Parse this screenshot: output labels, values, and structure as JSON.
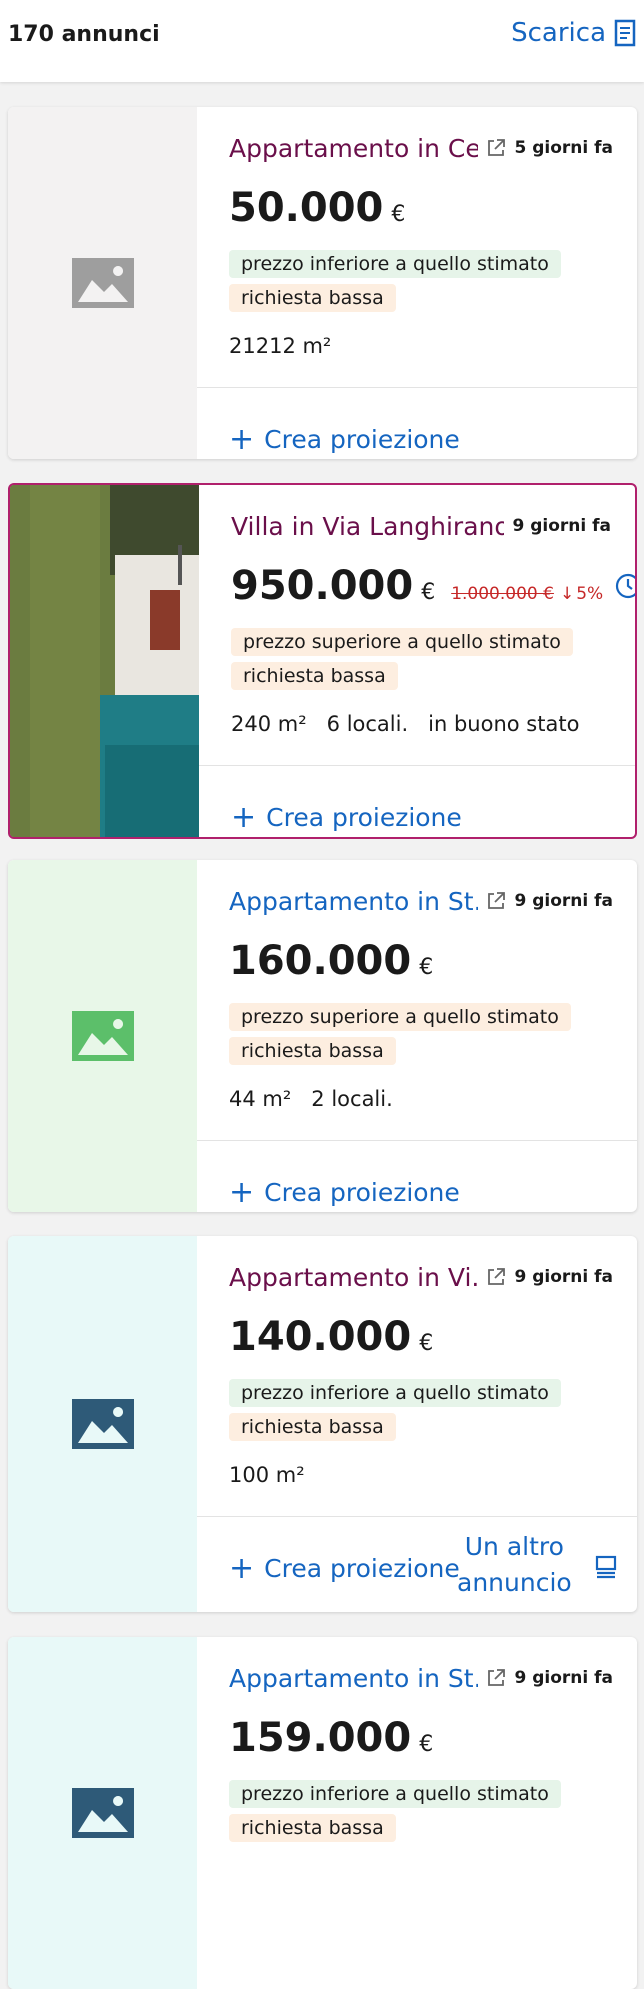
{
  "header": {
    "count": "170 annunci",
    "download_label": "Scarica"
  },
  "listings": [
    {
      "title": "Appartamento in Ce...",
      "age": "5 giorni fa",
      "price": "50.000",
      "currency": "€",
      "badges": [
        {
          "text": "prezzo inferiore a quello stimato",
          "kind": "green"
        },
        {
          "text": "richiesta bassa",
          "kind": "orange"
        }
      ],
      "features": "21212 m²",
      "action": "Crea proiezione",
      "thumb_bg": "#f3f2f2",
      "icon_color": "#9e9e9e"
    },
    {
      "title": "Villa in Via Langhirano",
      "age": "9 giorni fa",
      "price": "950.000",
      "currency": "€",
      "old_price": "1.000.000 €",
      "drop": "5%",
      "badges": [
        {
          "text": "prezzo superiore a quello stimato",
          "kind": "orange"
        },
        {
          "text": "richiesta bassa",
          "kind": "orange"
        }
      ],
      "features": "240 m²   6 locali.   in buono stato",
      "action": "Crea proiezione"
    },
    {
      "title": "Appartamento in St...",
      "age": "9 giorni fa",
      "price": "160.000",
      "currency": "€",
      "badges": [
        {
          "text": "prezzo superiore a quello stimato",
          "kind": "orange"
        },
        {
          "text": "richiesta bassa",
          "kind": "orange"
        }
      ],
      "features": "44 m²   2 locali.",
      "action": "Crea proiezione",
      "thumb_bg": "#e8f7e8",
      "icon_color": "#5cbf6a"
    },
    {
      "title": "Appartamento in Vi...",
      "age": "9 giorni fa",
      "price": "140.000",
      "currency": "€",
      "badges": [
        {
          "text": "prezzo inferiore a quello stimato",
          "kind": "green"
        },
        {
          "text": "richiesta bassa",
          "kind": "orange"
        }
      ],
      "features": "100 m²",
      "action": "Crea proiezione",
      "other_line1": "Un altro",
      "other_line2": "annuncio",
      "thumb_bg": "#e8f9f8",
      "icon_color": "#2e5a78"
    },
    {
      "title": "Appartamento in St...",
      "age": "9 giorni fa",
      "price": "159.000",
      "currency": "€",
      "badges": [
        {
          "text": "prezzo inferiore a quello stimato",
          "kind": "green"
        },
        {
          "text": "richiesta bassa",
          "kind": "orange"
        }
      ],
      "thumb_bg": "#e8f9f8",
      "icon_color": "#2e5a78"
    }
  ]
}
